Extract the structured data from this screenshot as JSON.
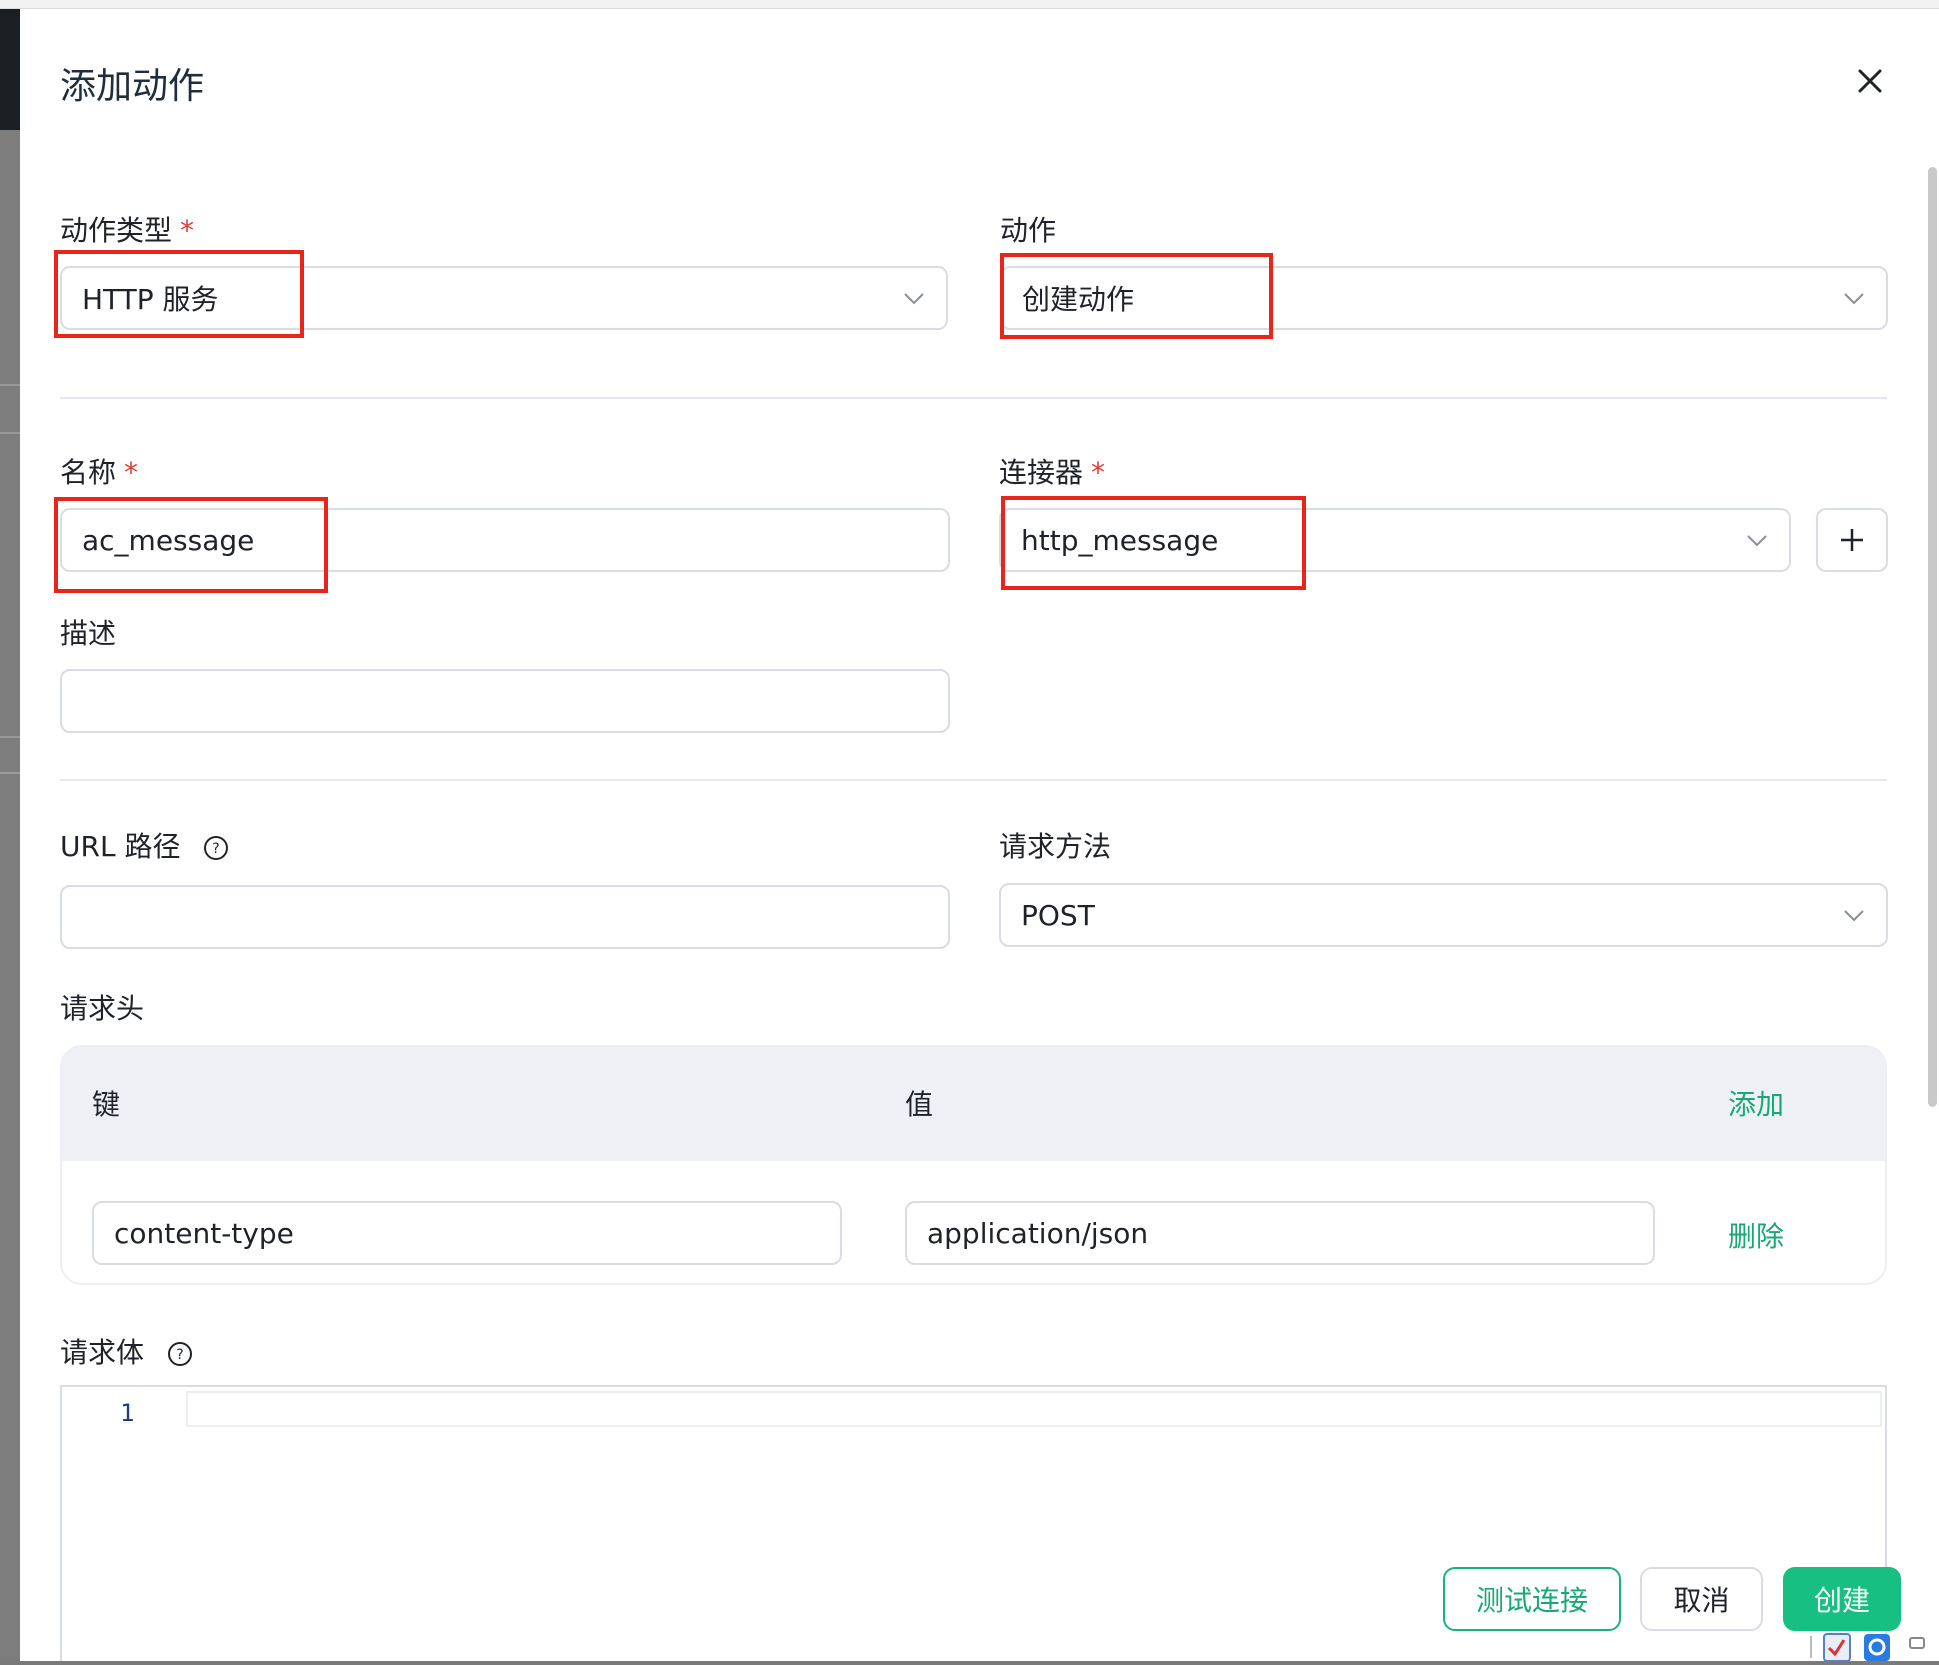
{
  "dialog": {
    "title": "添加动作",
    "create_label": "创建",
    "cancel_label": "取消",
    "test_label": "测试连接"
  },
  "form": {
    "action_type": {
      "label": "动作类型",
      "value": "HTTP 服务",
      "required": "*"
    },
    "action": {
      "label": "动作",
      "value": "创建动作"
    },
    "name": {
      "label": "名称",
      "value": "ac_message",
      "required": "*"
    },
    "connector": {
      "label": "连接器",
      "value": "http_message",
      "required": "*"
    },
    "description": {
      "label": "描述",
      "value": ""
    },
    "url_path": {
      "label": "URL 路径",
      "value": ""
    },
    "method": {
      "label": "请求方法",
      "value": "POST"
    },
    "headers": {
      "label": "请求头",
      "col_key": "键",
      "col_value": "值",
      "add_label": "添加",
      "rows": [
        {
          "key": "content-type",
          "value": "application/json",
          "delete_label": "删除"
        }
      ]
    },
    "body": {
      "label": "请求体",
      "line_number": "1"
    }
  },
  "colors": {
    "accent": "#17c082",
    "required": "#e03b3b",
    "highlight": "#e8241b"
  },
  "icons": [
    "close-icon",
    "chevron-down-icon",
    "plus-icon",
    "help-icon"
  ]
}
